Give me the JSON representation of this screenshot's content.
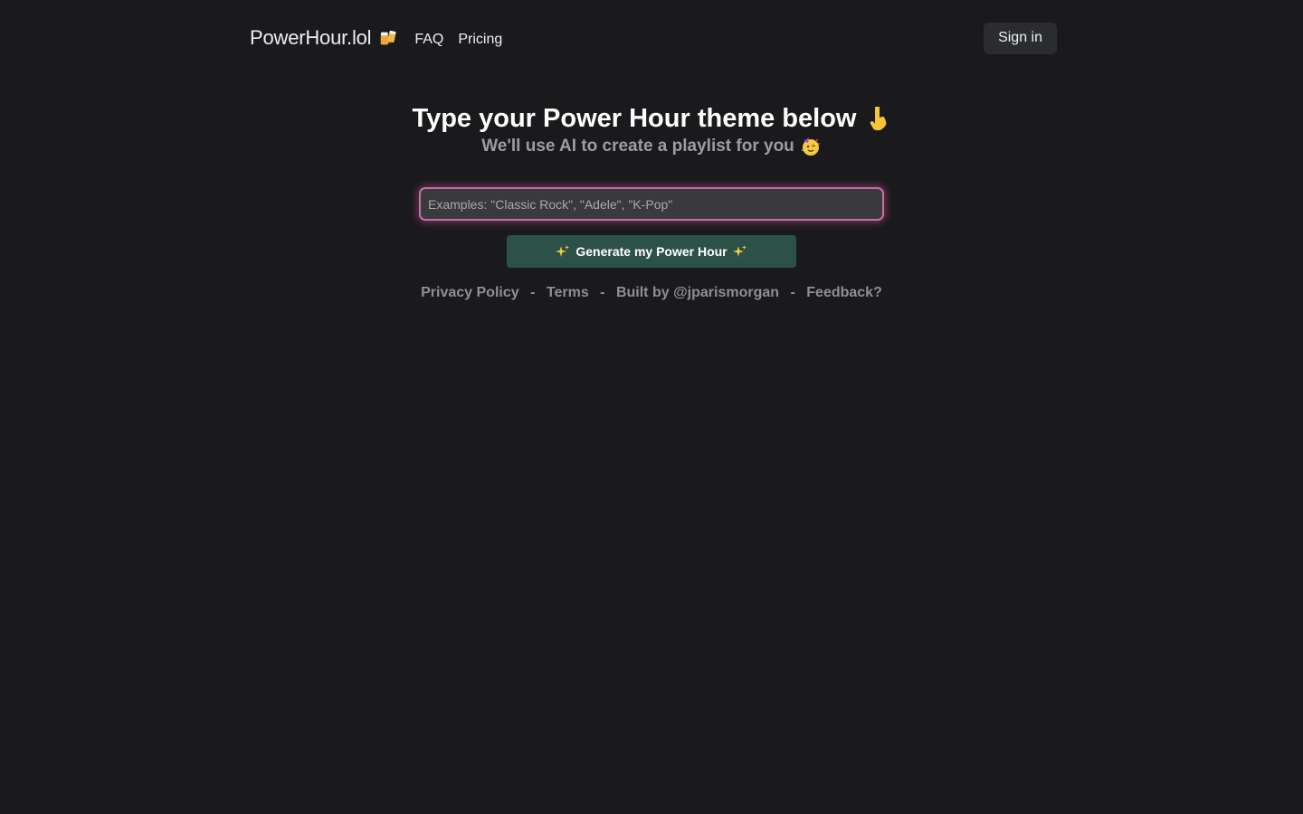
{
  "header": {
    "brand": "PowerHour.lol",
    "brand_icon": "beer-mugs-icon",
    "nav": [
      {
        "label": "FAQ"
      },
      {
        "label": "Pricing"
      }
    ],
    "signin_label": "Sign in"
  },
  "hero": {
    "title": "Type your Power Hour theme below",
    "title_icon": "pointing-down-hand-icon",
    "subtitle": "We'll use AI to create a playlist for you",
    "subtitle_icon": "partying-face-icon"
  },
  "form": {
    "input_placeholder": "Examples: \"Classic Rock\", \"Adele\", \"K-Pop\"",
    "input_value": "",
    "generate_label": "Generate my Power Hour",
    "generate_icon": "sparkles-icon"
  },
  "footer": {
    "links": [
      {
        "label": "Privacy Policy"
      },
      {
        "label": "Terms"
      },
      {
        "label": "Built by @jparismorgan"
      },
      {
        "label": "Feedback?"
      }
    ],
    "separator": "-"
  },
  "colors": {
    "background": "#1a1a1c",
    "accent_glow": "#c56fa5",
    "generate_button": "#2c5248",
    "signin_button": "#2b2c30"
  }
}
